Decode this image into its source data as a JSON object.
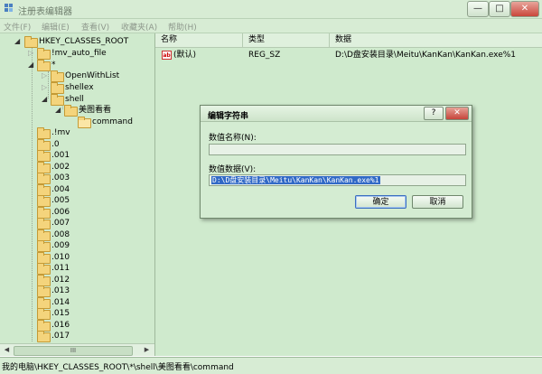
{
  "window": {
    "title": "注册表编辑器",
    "minimize_glyph": "—",
    "maximize_glyph": "□",
    "close_glyph": "✕"
  },
  "menu": {
    "items": [
      "文件(F)",
      "编辑(E)",
      "查看(V)",
      "收藏夹(A)",
      "帮助(H)"
    ]
  },
  "tree": {
    "root": "HKEY_CLASSES_ROOT",
    "level1": [
      {
        "label": "!mv_auto_file",
        "expander": "▷"
      },
      {
        "label": "*",
        "expander": "◢"
      }
    ],
    "star_children": [
      {
        "label": "OpenWithList",
        "expander": "▷"
      },
      {
        "label": "shellex",
        "expander": "▷"
      },
      {
        "label": "shell",
        "expander": "◢"
      }
    ],
    "shell_children": [
      {
        "label": "美图看看",
        "expander": "◢"
      }
    ],
    "meitu_children": [
      {
        "label": "command"
      }
    ],
    "siblings": [
      ".!mv",
      ".0",
      ".001",
      ".002",
      ".003",
      ".004",
      ".005",
      ".006",
      ".007",
      ".008",
      ".009",
      ".010",
      ".011",
      ".012",
      ".013",
      ".014",
      ".015",
      ".016",
      ".017"
    ],
    "hscroll_thumb_glyph": "III",
    "hscroll_left_glyph": "◀",
    "hscroll_right_glyph": "▶"
  },
  "list": {
    "columns": [
      "名称",
      "类型",
      "数据"
    ],
    "rows": [
      {
        "icon": "ab",
        "name": "(默认)",
        "type": "REG_SZ",
        "data": "D:\\D盘安装目录\\Meitu\\KanKan\\KanKan.exe%1"
      }
    ]
  },
  "dialog": {
    "title": "编辑字符串",
    "help_glyph": "?",
    "close_glyph": "✕",
    "name_label": "数值名称(N):",
    "name_value": "",
    "data_label": "数值数据(V):",
    "data_value": "D:\\D盘安装目录\\Meitu\\KanKan\\KanKan.exe%1",
    "ok_label": "确定",
    "cancel_label": "取消"
  },
  "status": {
    "path": "我的电脑\\HKEY_CLASSES_ROOT\\*\\shell\\美图看看\\command"
  }
}
